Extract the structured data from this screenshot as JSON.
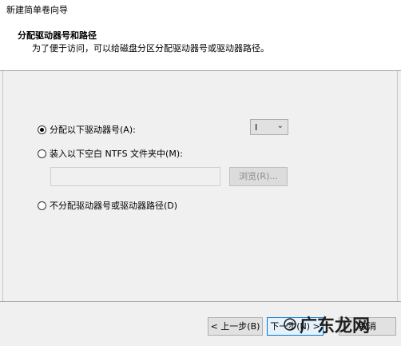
{
  "window": {
    "title": "新建简单卷向导"
  },
  "header": {
    "title": "分配驱动器号和路径",
    "subtitle": "为了便于访问，可以给磁盘分区分配驱动器号或驱动器路径。"
  },
  "options": {
    "assign_letter": {
      "label": "分配以下驱动器号(A):",
      "checked": true
    },
    "mount_folder": {
      "label": "装入以下空白 NTFS 文件夹中(M):",
      "checked": false
    },
    "no_assign": {
      "label": "不分配驱动器号或驱动器路径(D)",
      "checked": false
    }
  },
  "drive_letter": {
    "value": "I"
  },
  "folder_path": {
    "value": ""
  },
  "buttons": {
    "browse": "浏览(R)...",
    "back": "< 上一步(B)",
    "next": "下一步(N) >",
    "cancel": "取消"
  },
  "watermark": {
    "text": "广东龙网"
  }
}
